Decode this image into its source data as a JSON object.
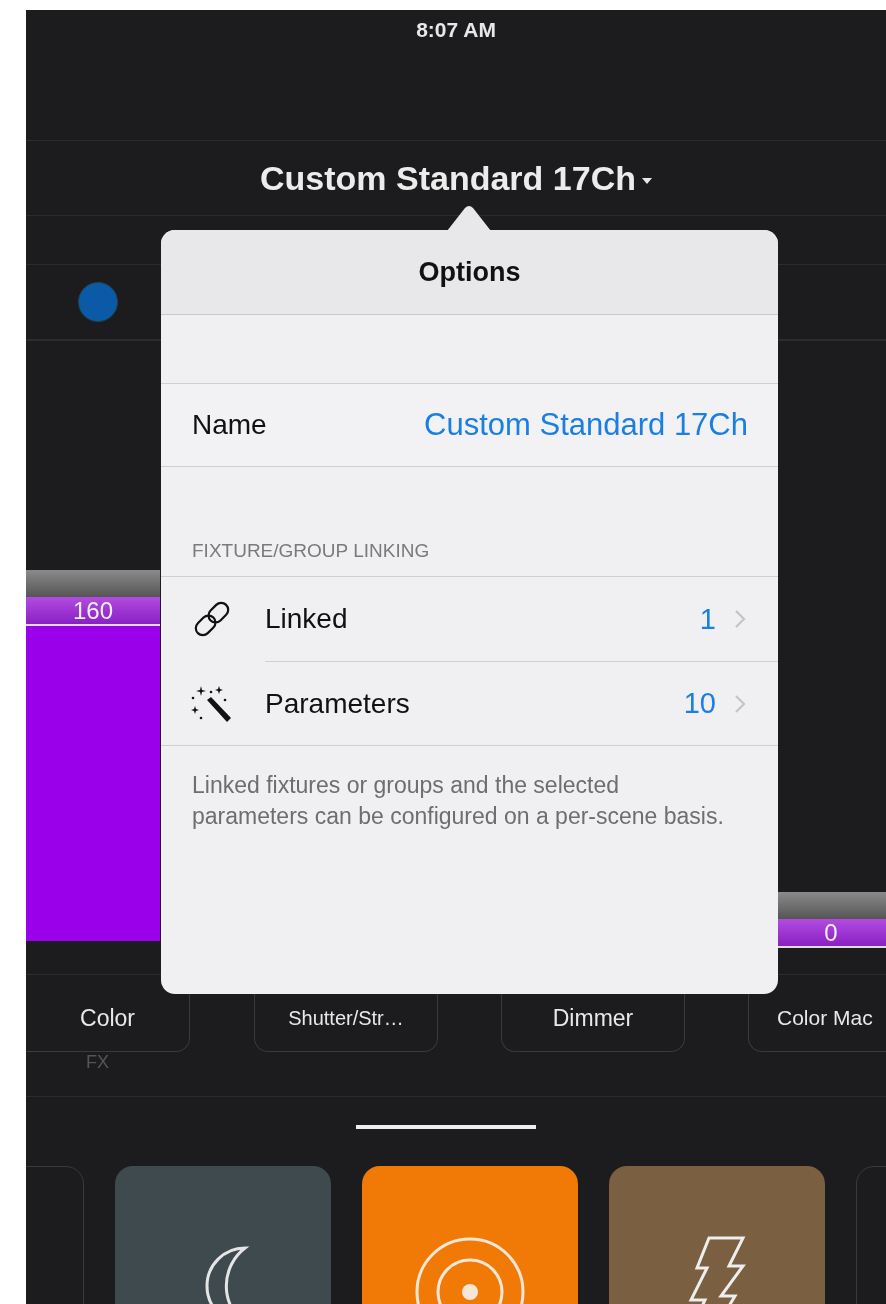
{
  "status_bar": {
    "time": "8:07 AM"
  },
  "header": {
    "title": "Custom Standard 17Ch"
  },
  "sliders": [
    {
      "value": "160"
    },
    {
      "value": "0"
    }
  ],
  "parameter_tabs": [
    {
      "label": "Color"
    },
    {
      "label": "Shutter/Str…"
    },
    {
      "label": "Dimmer"
    },
    {
      "label": "Color Mac"
    }
  ],
  "fx_label": "FX",
  "scene_tiles": [
    {
      "kind": "blank",
      "color": "#1c1c1e"
    },
    {
      "kind": "moon",
      "color": "#3f4a4f"
    },
    {
      "kind": "target",
      "color": "#f07a05"
    },
    {
      "kind": "bolt",
      "color": "#7a5f40"
    },
    {
      "kind": "blank",
      "color": "#1c1c1e"
    }
  ],
  "popover": {
    "title": "Options",
    "name_label": "Name",
    "name_value": "Custom Standard 17Ch",
    "section_header": "FIXTURE/GROUP LINKING",
    "rows": [
      {
        "kind": "link",
        "label": "Linked",
        "value": "1"
      },
      {
        "kind": "wand",
        "label": "Parameters",
        "value": "10"
      }
    ],
    "footer": "Linked fixtures or groups and the selected parameters can be configured on a per-scene basis."
  }
}
